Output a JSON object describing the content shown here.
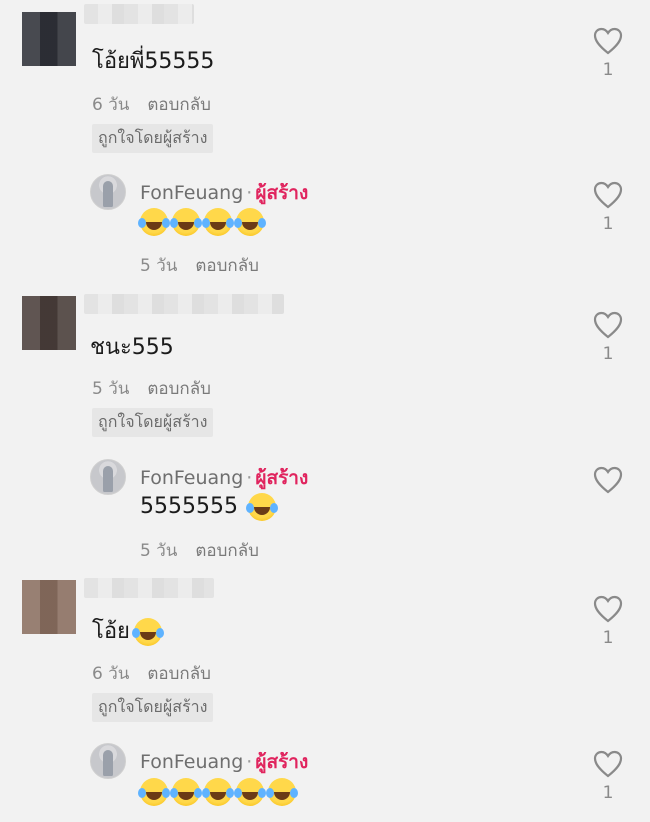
{
  "threads": [
    {
      "comment": {
        "text": "โอ้ยพี่55555",
        "time": "6 วัน",
        "reply_label": "ตอบกลับ",
        "liked_by_creator": "ถูกใจโดยผู้สร้าง",
        "likes": "1"
      },
      "reply": {
        "author": "FonFeuang",
        "separator": "·",
        "creator_tag": "ผู้สร้าง",
        "text": "",
        "emoji_count": 4,
        "time": "5 วัน",
        "reply_label": "ตอบกลับ",
        "likes": "1"
      }
    },
    {
      "comment": {
        "text": "ชนะ555",
        "time": "5 วัน",
        "reply_label": "ตอบกลับ",
        "liked_by_creator": "ถูกใจโดยผู้สร้าง",
        "likes": "1"
      },
      "reply": {
        "author": "FonFeuang",
        "separator": "·",
        "creator_tag": "ผู้สร้าง",
        "text": "5555555",
        "emoji_count": 1,
        "time": "5 วัน",
        "reply_label": "ตอบกลับ",
        "likes": ""
      }
    },
    {
      "comment": {
        "text": "โอ้ย",
        "emoji_count": 1,
        "time": "6 วัน",
        "reply_label": "ตอบกลับ",
        "liked_by_creator": "ถูกใจโดยผู้สร้าง",
        "likes": "1"
      },
      "reply": {
        "author": "FonFeuang",
        "separator": "·",
        "creator_tag": "ผู้สร้าง",
        "text": "",
        "emoji_count": 5,
        "time": "",
        "reply_label": "",
        "likes": "1"
      }
    }
  ],
  "icons": {
    "like": "heart-outline-icon",
    "emoji": "face-with-tears-of-joy-icon"
  },
  "colors": {
    "creator_tag": "#e0245e",
    "meta": "#8a8a8a",
    "background": "#f2f2f2"
  }
}
